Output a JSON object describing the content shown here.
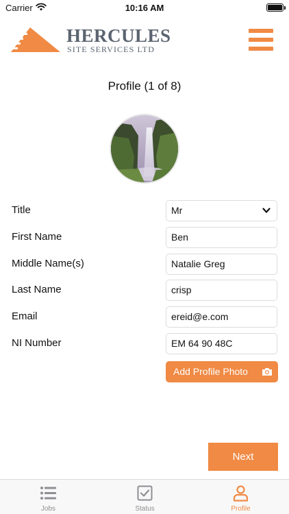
{
  "status_bar": {
    "carrier": "Carrier",
    "time": "10:16 AM",
    "battery_level": 1.0
  },
  "header": {
    "logo_title": "HERCULES",
    "logo_subtitle": "SITE SERVICES LTD",
    "menu_icon": "hamburger-menu-icon"
  },
  "page": {
    "title": "Profile (1 of 8)"
  },
  "avatar": {
    "icon": "profile-photo-waterfall"
  },
  "form": {
    "fields": [
      {
        "label": "Title",
        "value": "Mr",
        "type": "select"
      },
      {
        "label": "First Name",
        "value": "Ben"
      },
      {
        "label": "Middle Name(s)",
        "value": "Natalie Greg"
      },
      {
        "label": "Last Name",
        "value": "crisp"
      },
      {
        "label": "Email",
        "value": "ereid@e.com"
      },
      {
        "label": "NI Number",
        "value": "EM 64 90 48C"
      }
    ],
    "add_photo_label": "Add Profile Photo",
    "add_photo_icon": "camera-icon"
  },
  "actions": {
    "next_label": "Next"
  },
  "tab_bar": {
    "tabs": [
      {
        "label": "Jobs",
        "icon": "list-icon",
        "active": false
      },
      {
        "label": "Status",
        "icon": "checkbox-icon",
        "active": false
      },
      {
        "label": "Profile",
        "icon": "person-icon",
        "active": true
      }
    ]
  },
  "colors": {
    "accent": "#f08a44",
    "logo_text": "#5b6470",
    "tab_inactive": "#8e8e93"
  }
}
